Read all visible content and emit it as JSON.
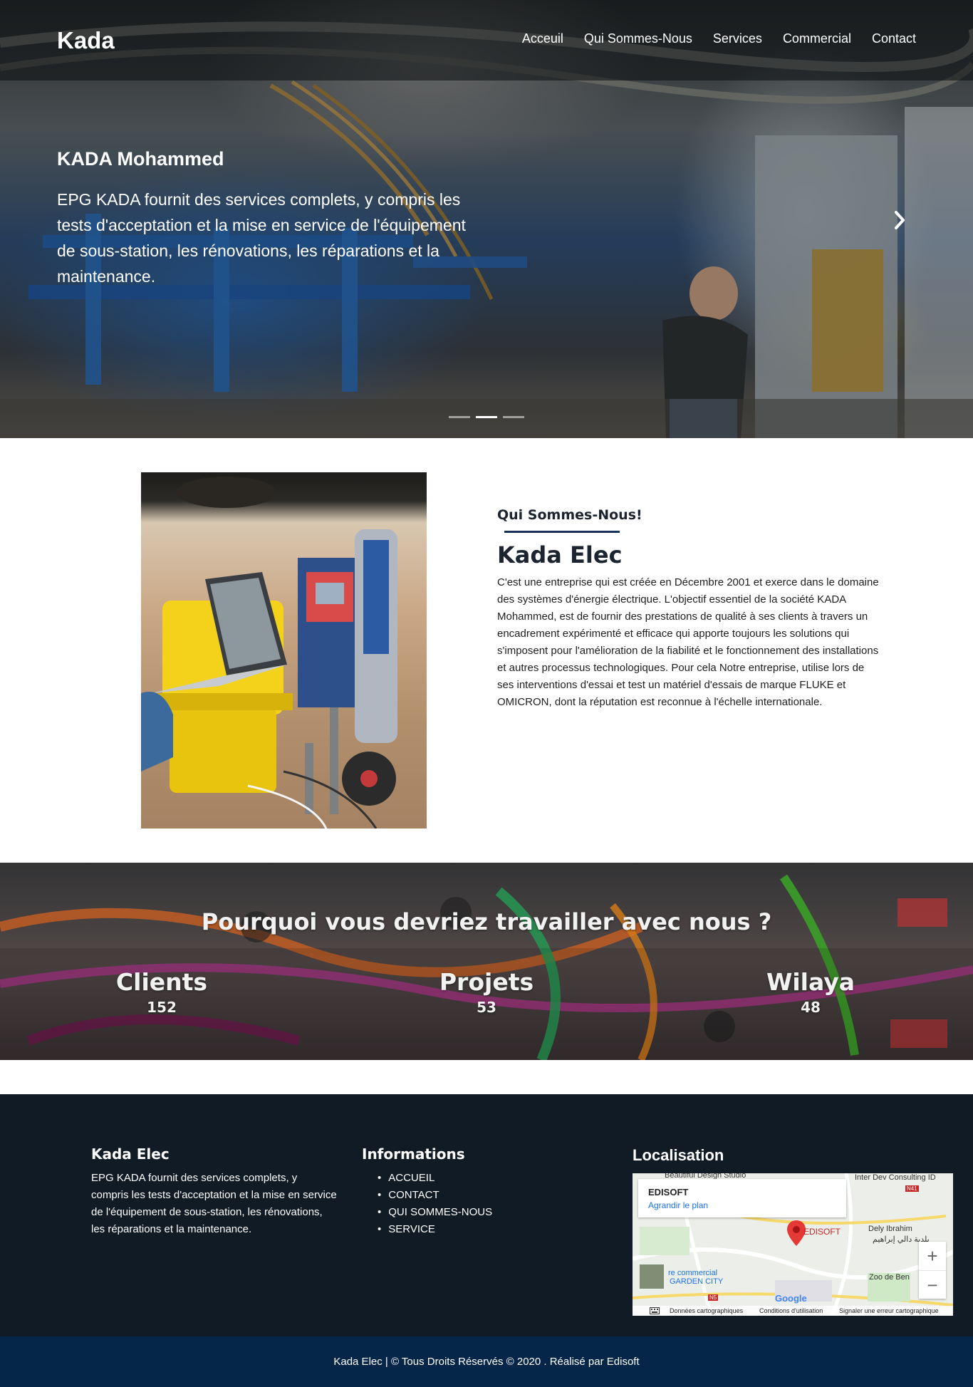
{
  "header": {
    "brand": "Kada",
    "nav": [
      "Acceuil",
      "Qui Sommes-Nous",
      "Services",
      "Commercial",
      "Contact"
    ]
  },
  "hero": {
    "title": "KADA Mohammed",
    "text": "EPG KADA fournit des services complets, y compris les tests d'acceptation et la mise en service de l'équipement de sous-station, les rénovations, les réparations et la maintenance.",
    "next_icon": "chevron-right-icon",
    "slides": 3,
    "active_slide": 2
  },
  "about": {
    "kicker": "Qui Sommes-Nous!",
    "title": "Kada Elec",
    "text": "C'est une entreprise qui est créée en Décembre 2001 et exerce dans le domaine des systèmes d'énergie électrique. L'objectif essentiel de la société KADA Mohammed, est de fournir des prestations de qualité à ses clients à travers un encadrement expérimenté et efficace qui apporte toujours les solutions qui s'imposent pour l'amélioration de la fiabilité et le fonctionnement des installations et autres processus technologiques. Pour cela Notre entreprise, utilise lors de ses interventions d'essai et test un matériel d'essais de marque FLUKE et OMICRON, dont la réputation est reconnue à l'échelle internationale."
  },
  "stats": {
    "title": "Pourquoi vous devriez travailler avec nous ?",
    "items": [
      {
        "label": "Clients",
        "value": "152"
      },
      {
        "label": "Projets",
        "value": "53"
      },
      {
        "label": "Wilaya",
        "value": "48"
      }
    ]
  },
  "footer": {
    "about_title": "Kada Elec",
    "about_text": "EPG KADA fournit des services complets, y compris les tests d'acceptation et la mise en service de l'équipement de sous-station, les rénovations, les réparations et la maintenance.",
    "info_title": "Informations",
    "links": [
      "ACCUEIL",
      "CONTACT",
      "QUI SOMMES-NOUS",
      "SERVICE"
    ],
    "loc_title": "Localisation",
    "map": {
      "place_name": "EDISOFT",
      "enlarge": "Agrandir le plan",
      "pin_label": "EDISOFT",
      "labels": [
        "Beautiful Design Studio",
        "Inter Dev Consulting ID",
        "Dely Ibrahim",
        "بلدية دالي إبراهيم",
        "re commercial",
        "GARDEN CITY",
        "Zoo de Ben",
        "N41",
        "N5",
        "Google"
      ],
      "zoom_in": "+",
      "zoom_out": "−",
      "footer": [
        "Données cartographiques",
        "Conditions d'utilisation",
        "Signaler une erreur cartographique"
      ]
    }
  },
  "copyright": "Kada Elec | © Tous Droits Réservés © 2020 . Réalisé par Edisoft",
  "colors": {
    "footer_bg": "#111b25",
    "copyright_bg": "#062649",
    "accent_rule": "#163257",
    "map_pin": "#e53935"
  }
}
